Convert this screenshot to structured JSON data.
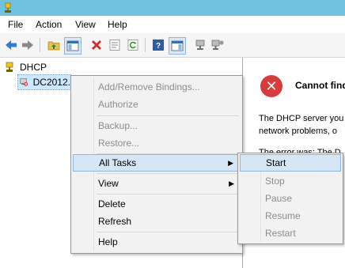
{
  "menubar": {
    "items": [
      "File",
      "Action",
      "View",
      "Help"
    ]
  },
  "toolbar": {
    "buttons": [
      "back-arrow-icon",
      "forward-arrow-icon",
      "up-folder-icon",
      "show-hide-console-tree-icon",
      "delete-icon",
      "properties-icon",
      "refresh-icon",
      "help-icon",
      "show-action-pane-icon",
      "server-icon",
      "server-options-icon"
    ]
  },
  "tree": {
    "root_label": "DHCP",
    "child_label": "DC2012."
  },
  "error_panel": {
    "title": "Cannot find",
    "line1": "The DHCP server you",
    "line2": "network problems, o",
    "line3": "The error was: The D"
  },
  "context_menu": {
    "add_remove_bindings": "Add/Remove Bindings...",
    "authorize": "Authorize",
    "backup": "Backup...",
    "restore": "Restore...",
    "all_tasks": "All Tasks",
    "view": "View",
    "delete": "Delete",
    "refresh": "Refresh",
    "help": "Help"
  },
  "submenu": {
    "start": "Start",
    "stop": "Stop",
    "pause": "Pause",
    "resume": "Resume",
    "restart": "Restart"
  },
  "colors": {
    "titlebar": "#6fc3df",
    "error_red": "#d93a3a",
    "highlight": "#d5e6f7"
  }
}
